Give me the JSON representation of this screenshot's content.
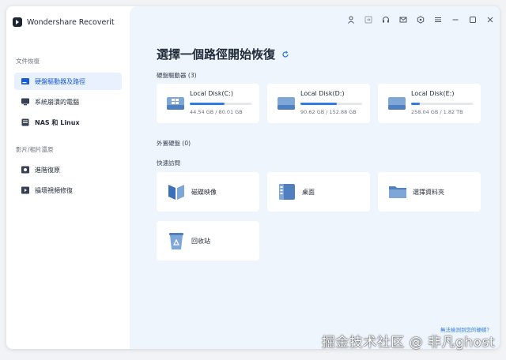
{
  "app": {
    "title": "Wondershare Recoverit"
  },
  "sidebar": {
    "section1": "文件恢復",
    "items1": [
      {
        "label": "硬盤驅動器及路徑",
        "icon": "hard-drive-icon"
      },
      {
        "label": "系統崩潰的電腦",
        "icon": "monitor-icon"
      },
      {
        "label": "NAS 和 Linux",
        "icon": "nas-icon"
      }
    ],
    "section2": "影片/相片還原",
    "items2": [
      {
        "label": "進階復原",
        "icon": "advanced-recovery-icon"
      },
      {
        "label": "損壞視頻修復",
        "icon": "video-repair-icon"
      }
    ]
  },
  "topbar": {
    "icons": [
      "user-icon",
      "export-icon",
      "headset-icon",
      "mail-icon",
      "settings-icon",
      "menu-icon",
      "minimize-icon",
      "maximize-icon",
      "close-icon"
    ]
  },
  "main": {
    "title": "選擇一個路徑開始恢復",
    "hard_drives_label": "硬盤驅動器",
    "hard_drives_count": "(3)",
    "disks": [
      {
        "name": "Local Disk(C:)",
        "size": "44.54 GB / 80.01 GB",
        "used_fraction": 0.56
      },
      {
        "name": "Local Disk(D:)",
        "size": "90.62 GB / 152.88 GB",
        "used_fraction": 0.59
      },
      {
        "name": "Local Disk(E:)",
        "size": "258.04 GB / 1.82 TB",
        "used_fraction": 0.14
      }
    ],
    "external_label": "外置硬盤",
    "external_count": "(0)",
    "quick_label": "快速訪問",
    "quick": [
      {
        "label": "磁碟映像"
      },
      {
        "label": "桌面"
      },
      {
        "label": "選擇資料夾"
      },
      {
        "label": "回收站"
      }
    ],
    "bottom_link": "無法檢測到您的硬碟？"
  },
  "watermark": "掘金技术社区 @ 非凡ghost",
  "colors": {
    "accent": "#2f7ce5",
    "active_bg": "#e8f1fd",
    "main_bg": "#eef5fd"
  }
}
